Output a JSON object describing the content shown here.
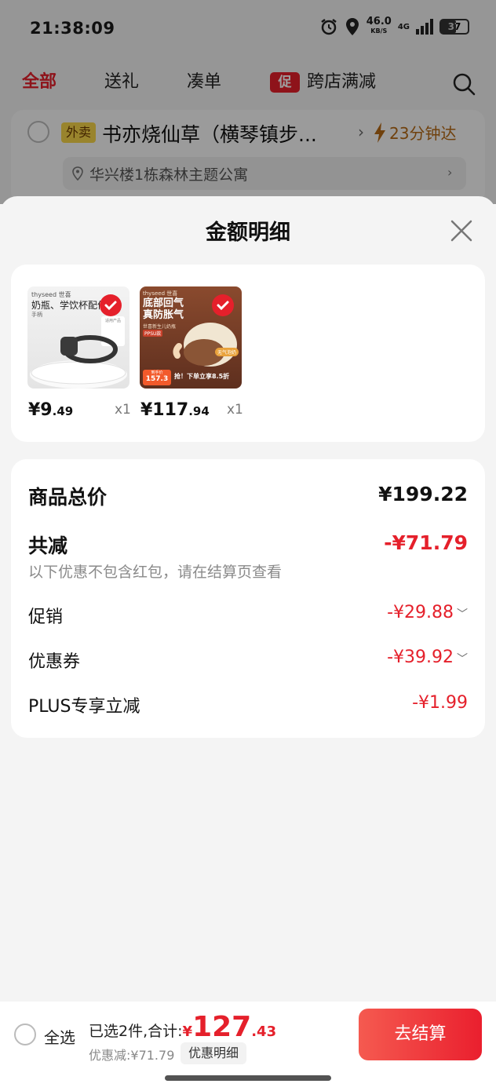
{
  "status_bar": {
    "time": "21:38:09",
    "net_speed": "46.0",
    "net_unit": "KB/S",
    "net_type": "4G",
    "battery": "37"
  },
  "tabs": [
    {
      "label": "全部",
      "active": true
    },
    {
      "label": "送礼",
      "active": false
    },
    {
      "label": "凑单",
      "active": false
    },
    {
      "label": "跨店满减",
      "active": false,
      "badge": "促"
    }
  ],
  "store": {
    "tag": "外卖",
    "name": "书亦烧仙草（横琴镇步...",
    "delivery_time": "23分钟达",
    "address": "华兴楼1栋森林主题公寓"
  },
  "sheet": {
    "title": "金额明细"
  },
  "products": [
    {
      "price_int": "¥9",
      "price_dec": ".49",
      "qty": "x1",
      "img_brand": "thyseed 世喜",
      "img_title": "奶瓶、学饮杯配件",
      "img_sub": "手柄",
      "img_label": "适用产品"
    },
    {
      "price_int": "¥117",
      "price_dec": ".94",
      "qty": "x1",
      "img_brand": "thyseed 世喜",
      "img_title": "底部回气",
      "img_title2": "真防胀气",
      "img_sub": "世喜新生儿奶瓶",
      "img_tag": "PPSU款",
      "img_badge": "无气泡奶",
      "img_price_label": "到手价",
      "img_price": "157.3",
      "img_promo": "抢！下单立享8.5折"
    }
  ],
  "summary": {
    "total_label": "商品总价",
    "total_value": "¥199.22",
    "reduce_label": "共减",
    "reduce_value": "-¥71.79",
    "note": "以下优惠不包含红包，请在结算页查看",
    "items": [
      {
        "label": "促销",
        "value": "-¥29.88",
        "expandable": true
      },
      {
        "label": "优惠券",
        "value": "-¥39.92",
        "expandable": true
      },
      {
        "label": "PLUS专享立减",
        "value": "-¥1.99",
        "expandable": false
      }
    ]
  },
  "bottom_bar": {
    "select_all": "全选",
    "selected_prefix": "已选2件,合计:",
    "total_yen": "¥",
    "total_int": "127",
    "total_dec": ".43",
    "discount_line": "优惠减:¥71.79",
    "detail_chip": "优惠明细",
    "checkout": "去结算"
  },
  "colors": {
    "accent": "#e5202b",
    "price_text": "#111111",
    "tag_yellow": "#f7d54a"
  },
  "icons": [
    "alarm-icon",
    "location-icon",
    "signal-icon",
    "battery-icon",
    "search-icon",
    "bolt-icon",
    "pin-icon",
    "close-icon",
    "check-icon",
    "chevron-down-icon",
    "chevron-right-icon"
  ]
}
